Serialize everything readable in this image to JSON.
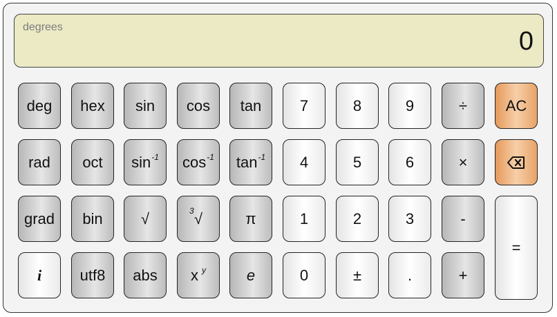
{
  "display": {
    "mode": "degrees",
    "value": "0"
  },
  "keys": {
    "deg": "deg",
    "hex": "hex",
    "sin": "sin",
    "cos": "cos",
    "tan": "tan",
    "seven": "7",
    "eight": "8",
    "nine": "9",
    "divide": "÷",
    "ac": "AC",
    "rad": "rad",
    "oct": "oct",
    "asin_base": "sin",
    "acos_base": "cos",
    "atan_base": "tan",
    "inv_exp": "-1",
    "four": "4",
    "five": "5",
    "six": "6",
    "multiply": "×",
    "grad": "grad",
    "bin": "bin",
    "sqrt": "√",
    "cbrt_index": "3",
    "cbrt_sign": "√",
    "pi": "π",
    "one": "1",
    "two": "2",
    "three": "3",
    "minus": "-",
    "equals": "=",
    "i": "i",
    "utf8": "utf8",
    "abs": "abs",
    "pow_base": "x",
    "pow_exp": "y",
    "e": "e",
    "zero": "0",
    "plus_minus": "±",
    "dot": ".",
    "plus": "+"
  },
  "icons": {
    "backspace": "backspace-icon"
  }
}
